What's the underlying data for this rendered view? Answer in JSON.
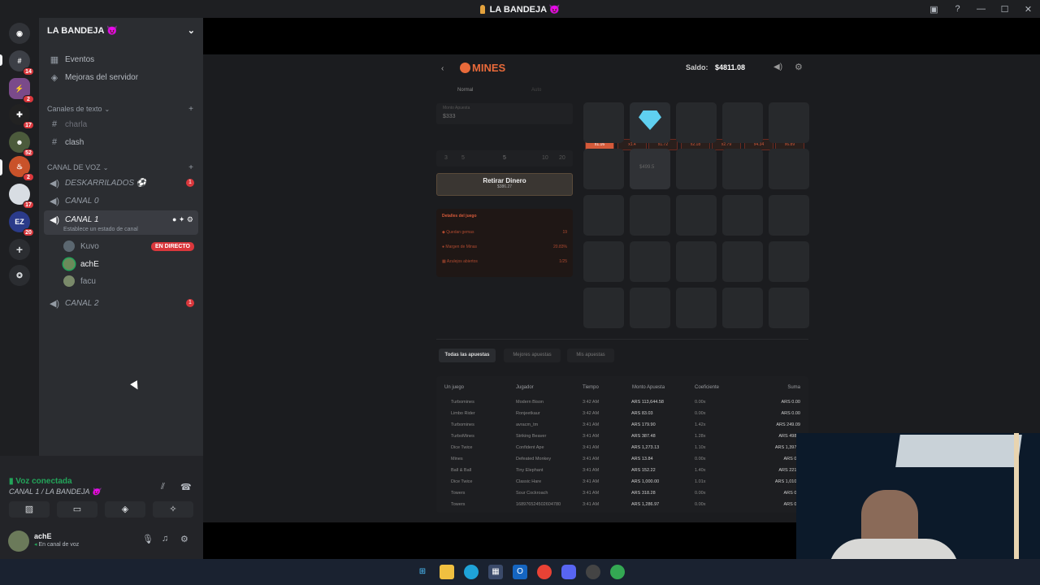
{
  "window": {
    "title": "LA BANDEJA 😈",
    "icons": [
      "cast-icon",
      "help-icon",
      "minimize-icon",
      "maximize-icon",
      "close-icon"
    ]
  },
  "guilds": [
    {
      "name": "discord-home",
      "badge": ""
    },
    {
      "name": "server-1",
      "badge": "14"
    },
    {
      "name": "server-2",
      "badge": "2"
    },
    {
      "name": "server-3",
      "badge": "17"
    },
    {
      "name": "server-4",
      "badge": "52"
    },
    {
      "name": "server-5",
      "badge": "2"
    },
    {
      "name": "server-6",
      "badge": "17"
    },
    {
      "name": "server-7",
      "badge": "20"
    }
  ],
  "server": {
    "name": "LA BANDEJA 😈",
    "events": "Eventos",
    "boosts": "Mejoras del servidor",
    "text_category": "Canales de texto",
    "text_channels": [
      "charla",
      "clash"
    ],
    "voice_category": "CANAL DE VOZ",
    "voice_channels": [
      {
        "name": "DESKARRILADOS ⚽",
        "badge": "1"
      },
      {
        "name": "CANAL 0"
      },
      {
        "name": "CANAL 1",
        "status": "Establece un estado de canal"
      },
      {
        "name": "CANAL 2",
        "badge": "1"
      }
    ],
    "members": [
      {
        "name": "Kuvo",
        "live": "EN DIRECTO"
      },
      {
        "name": "achE"
      },
      {
        "name": "facu"
      }
    ]
  },
  "voice": {
    "status": "Voz conectada",
    "location": "CANAL 1 / LA BANDEJA 😈"
  },
  "user": {
    "name": "achE",
    "status": "En canal de voz"
  },
  "game": {
    "logo": "MINES",
    "balance_label": "Saldo:",
    "balance": "$4811.08",
    "modes": [
      "Normal",
      "Auto"
    ],
    "bet_label": "Monto Apuesta",
    "bet_value": "$333",
    "mines_value": "5",
    "mines_options": [
      "3",
      "5",
      "10",
      "20"
    ],
    "cashout_label": "Retirar Dinero",
    "cashout_value": "$386.27",
    "multipliers": [
      "x1.16",
      "x1.4",
      "x1.72",
      "x2.18",
      "x2.79",
      "x4.34",
      "x6.89"
    ],
    "hover_value": "$499.5",
    "details_title": "Detalles del juego",
    "details": [
      {
        "label": "Quedan gemas",
        "value": "19"
      },
      {
        "label": "Margen de Minas",
        "value": "20.83%"
      },
      {
        "label": "Azulejos abiertos",
        "value": "1/25"
      }
    ],
    "tabs": [
      "Todas las apuestas",
      "Mejores apuestas",
      "Mis apuestas"
    ],
    "table_headers": [
      "Un juego",
      "Jugador",
      "Tiempo",
      "Monto Apuesta",
      "Coeficiente",
      "Suma"
    ],
    "rows": [
      [
        "Turbomines",
        "Modern Bison",
        "3:42 AM",
        "ARS 113,644.58",
        "0.00x",
        "ARS 0.00"
      ],
      [
        "Limbo Rider",
        "Ronjeetkaur",
        "3:42 AM",
        "ARS 83.03",
        "0.00x",
        "ARS 0.00"
      ],
      [
        "Turbomines",
        "avracm_tm",
        "3:41 AM",
        "ARS 179.90",
        "1.42x",
        "ARS 249.09"
      ],
      [
        "TurboMines",
        "Striking Beaver",
        "3:41 AM",
        "ARS 387.48",
        "1.28x",
        "ARS 498.1"
      ],
      [
        "Dice Twice",
        "Confident Ape",
        "3:41 AM",
        "ARS 1,273.13",
        "1.10x",
        "ARS 1,397.6"
      ],
      [
        "Mines",
        "Defeated Monkey",
        "3:41 AM",
        "ARS 13.84",
        "0.00x",
        "ARS 0.0"
      ],
      [
        "Ball & Ball",
        "Tiny Elephant",
        "3:41 AM",
        "ARS 152.22",
        "1.40x",
        "ARS 221.4"
      ],
      [
        "Dice Twice",
        "Classic Hare",
        "3:41 AM",
        "ARS 1,000.00",
        "1.01x",
        "ARS 1,010.0"
      ],
      [
        "Towers",
        "Sour Cockroach",
        "3:41 AM",
        "ARS 318.28",
        "0.00x",
        "ARS 0.0"
      ],
      [
        "Towers",
        "168976524502604780",
        "3:41 AM",
        "ARS 1,286.97",
        "0.00x",
        "ARS 0.0"
      ]
    ]
  },
  "taskbar": [
    "windows-icon",
    "file-explorer-icon",
    "edge-icon",
    "store-icon",
    "outlook-icon",
    "chrome-icon",
    "discord-icon",
    "obs-icon",
    "chrome-alt-icon"
  ],
  "colors": {
    "accent": "#5865f2",
    "danger": "#da373c",
    "online": "#23a55a",
    "game_orange": "#e86a3a"
  }
}
